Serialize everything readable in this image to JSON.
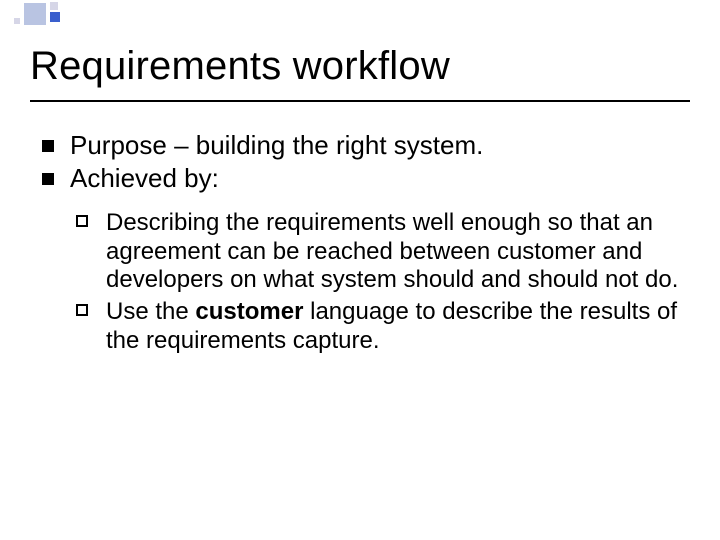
{
  "title": "Requirements workflow",
  "bullets": {
    "l1": [
      "Purpose – building the right system.",
      "Achieved by:"
    ],
    "l2": [
      {
        "pre": "Describing the requirements well enough so that an agreement can be reached between customer and developers on what system should and should not do.",
        "bold": "",
        "post": ""
      },
      {
        "pre": "Use the ",
        "bold": "customer",
        "post": " language to describe the results of the requirements capture."
      }
    ]
  }
}
